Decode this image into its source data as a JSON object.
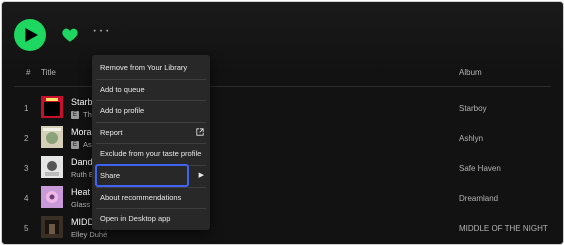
{
  "controls": {
    "more_label": "···"
  },
  "columns": {
    "number": "#",
    "title": "Title",
    "album": "Album"
  },
  "tracks": [
    {
      "number": "1",
      "title": "Starb",
      "artist": "Th",
      "explicit": "E",
      "album": "Starboy",
      "cover_colors": [
        "#c8102e",
        "#000000",
        "#f5e663"
      ]
    },
    {
      "number": "2",
      "title": "Mora",
      "artist": "As",
      "explicit": "E",
      "album": "Ashlyn",
      "cover_colors": [
        "#d6d0b8",
        "#8aa37a",
        "#f2f0e6"
      ]
    },
    {
      "number": "3",
      "title": "Dand",
      "artist": "Ruth E",
      "explicit": "",
      "album": "Safe Haven",
      "cover_colors": [
        "#e6e6e6",
        "#555555",
        "#bbbbbb"
      ]
    },
    {
      "number": "4",
      "title": "Heat",
      "artist": "Glass",
      "explicit": "",
      "album": "Dreamland",
      "cover_colors": [
        "#c89ad8",
        "#f0b7e6",
        "#6a3f7a"
      ]
    },
    {
      "number": "5",
      "title": "MIDD",
      "artist": "Elley Duhé",
      "explicit": "",
      "album": "MIDDLE OF THE NIGHT",
      "cover_colors": [
        "#3a2f24",
        "#1a1410",
        "#6e5a44"
      ]
    }
  ],
  "menu": {
    "items": [
      {
        "label": "Remove from Your Library"
      },
      {
        "label": "Add to queue"
      },
      {
        "label": "Add to profile"
      },
      {
        "label": "Report"
      },
      {
        "label": "Exclude from your taste profile"
      },
      {
        "label": "Share"
      },
      {
        "label": "About recommendations"
      },
      {
        "label": "Open in Desktop app"
      }
    ]
  },
  "colors": {
    "accent": "#1ed760",
    "highlight_outline": "#3f63f0",
    "menu_bg": "#282828",
    "page_bg": "#121212"
  }
}
